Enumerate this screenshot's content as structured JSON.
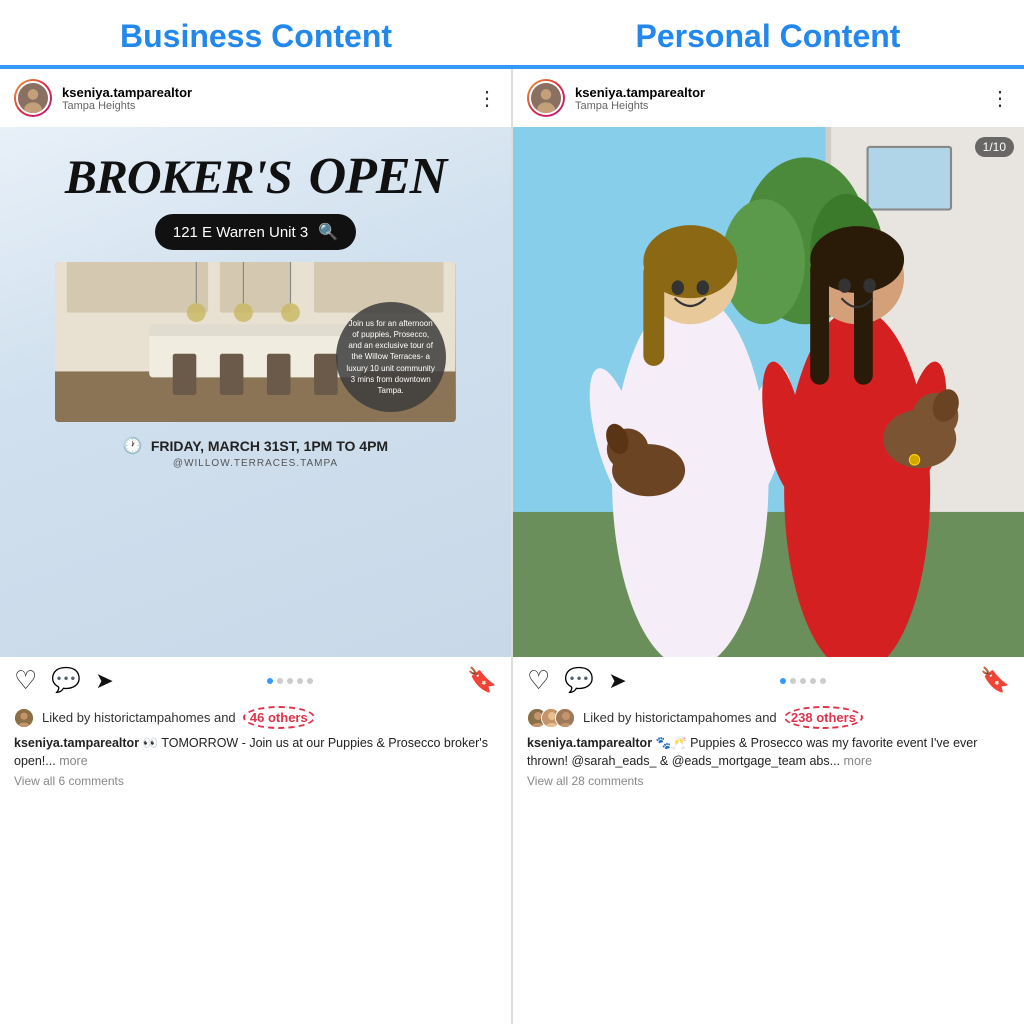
{
  "header": {
    "left_title": "Business Content",
    "right_title": "Personal Content"
  },
  "left_panel": {
    "username": "kseniya.tamparealtor",
    "location": "Tampa Heights",
    "post_image": {
      "broker_title_1": "BROKER'S",
      "broker_title_2": "OPEN",
      "address": "121 E Warren Unit 3",
      "overlay_text": "Join us for an afternoon of puppies, Prosecco, and an exclusive tour of the Willow Terraces- a luxury 10 unit community 3 mins from downtown Tampa.",
      "event_date": "FRIDAY, MARCH 31ST,  1PM TO 4PM",
      "event_handle": "@WILLOW.TERRACES.TAMPA"
    },
    "actions": {
      "like_icon": "♡",
      "comment_icon": "○",
      "share_icon": "▷",
      "bookmark_icon": "⊘"
    },
    "likes_text": "Liked by historictampahomes and",
    "likes_count": "46 others",
    "caption_user": "kseniya.tamparealtor",
    "caption_emoji": "👀",
    "caption_text": " TOMORROW - Join us at our Puppies & Prosecco broker's open!...",
    "caption_more": " more",
    "comments_link": "View all 6 comments"
  },
  "right_panel": {
    "username": "kseniya.tamparealtor",
    "location": "Tampa Heights",
    "post_image": {
      "image_counter": "1/10"
    },
    "actions": {
      "like_icon": "♡",
      "comment_icon": "○",
      "share_icon": "▷",
      "bookmark_icon": "⊘"
    },
    "likes_text": "Liked by historictampahomes and",
    "likes_count": "238 others",
    "caption_user": "kseniya.tamparealtor",
    "caption_emoji": "🐾🥂",
    "caption_text": " Puppies & Prosecco was my favorite event I've ever thrown! @sarah_eads_ & @eads_mortgage_team abs...",
    "caption_more": " more",
    "comments_link": "View all 28 comments"
  }
}
